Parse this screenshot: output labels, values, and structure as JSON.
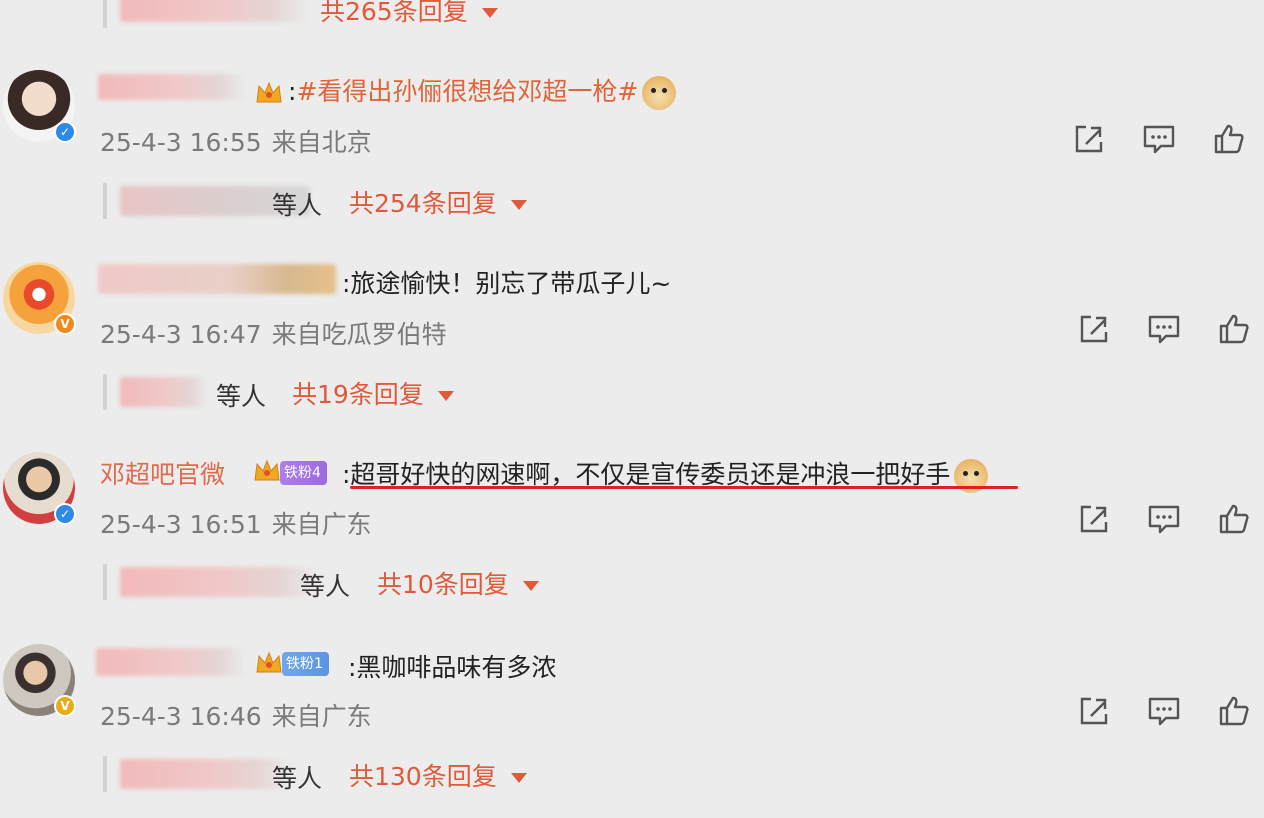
{
  "comments": [
    {
      "content_topic": "#看得出孙俪很想给邓超一枪#",
      "time": "25-4-3 16:55",
      "location": "来自北京",
      "verify_badge": "blue",
      "reply": {
        "others": "等人",
        "total": "共254条回复"
      }
    },
    {
      "content": ":旅途愉快！别忘了带瓜子儿~",
      "time": "25-4-3 16:47",
      "location": "来自吃瓜罗伯特",
      "verify_badge": "orange",
      "reply": {
        "others": "等人",
        "total": "共19条回复"
      }
    },
    {
      "author": "邓超吧官微",
      "fan_badge": "铁粉4",
      "content": ":超哥好快的网速啊，不仅是宣传委员还是冲浪一把好手",
      "time": "25-4-3 16:51",
      "location": "来自广东",
      "verify_badge": "blue",
      "reply": {
        "others": "等人",
        "total": "共10条回复"
      }
    },
    {
      "fan_badge": "铁粉1",
      "content": ":黑咖啡品味有多浓",
      "time": "25-4-3 16:46",
      "location": "来自广东",
      "verify_badge": "gold",
      "reply": {
        "others": "等人",
        "total": "共130条回复"
      }
    }
  ],
  "top_partial_reply": {
    "total": "共265条回复"
  },
  "icons": {
    "share": "share-icon",
    "comment": "comment-icon",
    "like": "like-icon",
    "verified": "verified-icon",
    "crown": "crown-icon",
    "expand": "chevron-down-icon"
  },
  "colors": {
    "name": "#e06a4c",
    "reply_total": "#e05a3a",
    "underline": "#e02020",
    "verified_blue": "#2f8ae6"
  }
}
